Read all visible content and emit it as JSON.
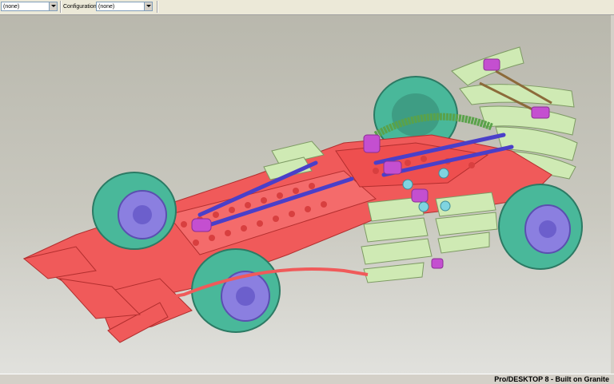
{
  "toolbar": {
    "first_select_value": "(none)",
    "configuration_label": "Configuration:",
    "configuration_value": "(none)"
  },
  "viewport": {
    "model_description": "3D assembly of a Lego Technic Formula 1 race car",
    "colors": {
      "chassis": "#f05a5a",
      "tires": "#49b89a",
      "rims": "#8b7fe0",
      "panels": "#cfeab4",
      "rods": "#4a3fc9",
      "connectors": "#c44fd0",
      "hose": "#5aa24a"
    }
  },
  "status": {
    "text": "Pro/DESKTOP 8 - Built on Granite"
  }
}
